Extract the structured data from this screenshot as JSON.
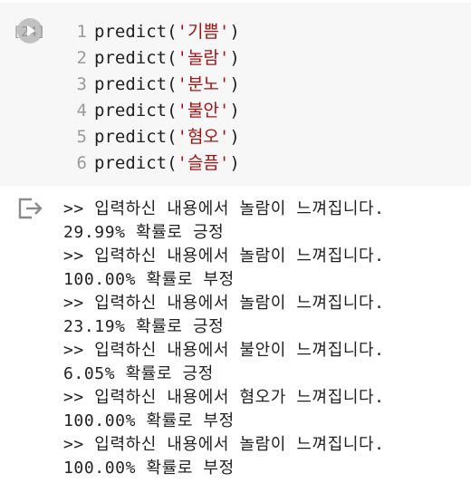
{
  "cell": {
    "execution_count": "[24]",
    "lines": [
      {
        "num": "1",
        "fn": "predict(",
        "arg": "'기쁨'",
        "close": ")"
      },
      {
        "num": "2",
        "fn": "predict(",
        "arg": "'놀람'",
        "close": ")"
      },
      {
        "num": "3",
        "fn": "predict(",
        "arg": "'분노'",
        "close": ")"
      },
      {
        "num": "4",
        "fn": "predict(",
        "arg": "'불안'",
        "close": ")"
      },
      {
        "num": "5",
        "fn": "predict(",
        "arg": "'혐오'",
        "close": ")"
      },
      {
        "num": "6",
        "fn": "predict(",
        "arg": "'슬픔'",
        "close": ")"
      }
    ]
  },
  "output": {
    "icon": "output-redirect-icon",
    "lines": [
      ">> 입력하신 내용에서 놀람이 느껴집니다.",
      "29.99% 확률로 긍정",
      ">> 입력하신 내용에서 놀람이 느껴집니다.",
      "100.00% 확률로 부정",
      ">> 입력하신 내용에서 놀람이 느껴집니다.",
      "23.19% 확률로 긍정",
      ">> 입력하신 내용에서 불안이 느껴집니다.",
      "6.05% 확률로 긍정",
      ">> 입력하신 내용에서 혐오가 느껴집니다.",
      "100.00% 확률로 부정",
      ">> 입력하신 내용에서 놀람이 느껴집니다.",
      "100.00% 확률로 부정"
    ]
  },
  "colors": {
    "cell_background": "#f7f7f7",
    "string_color": "#a31515",
    "line_number_color": "#9a9a9a"
  }
}
